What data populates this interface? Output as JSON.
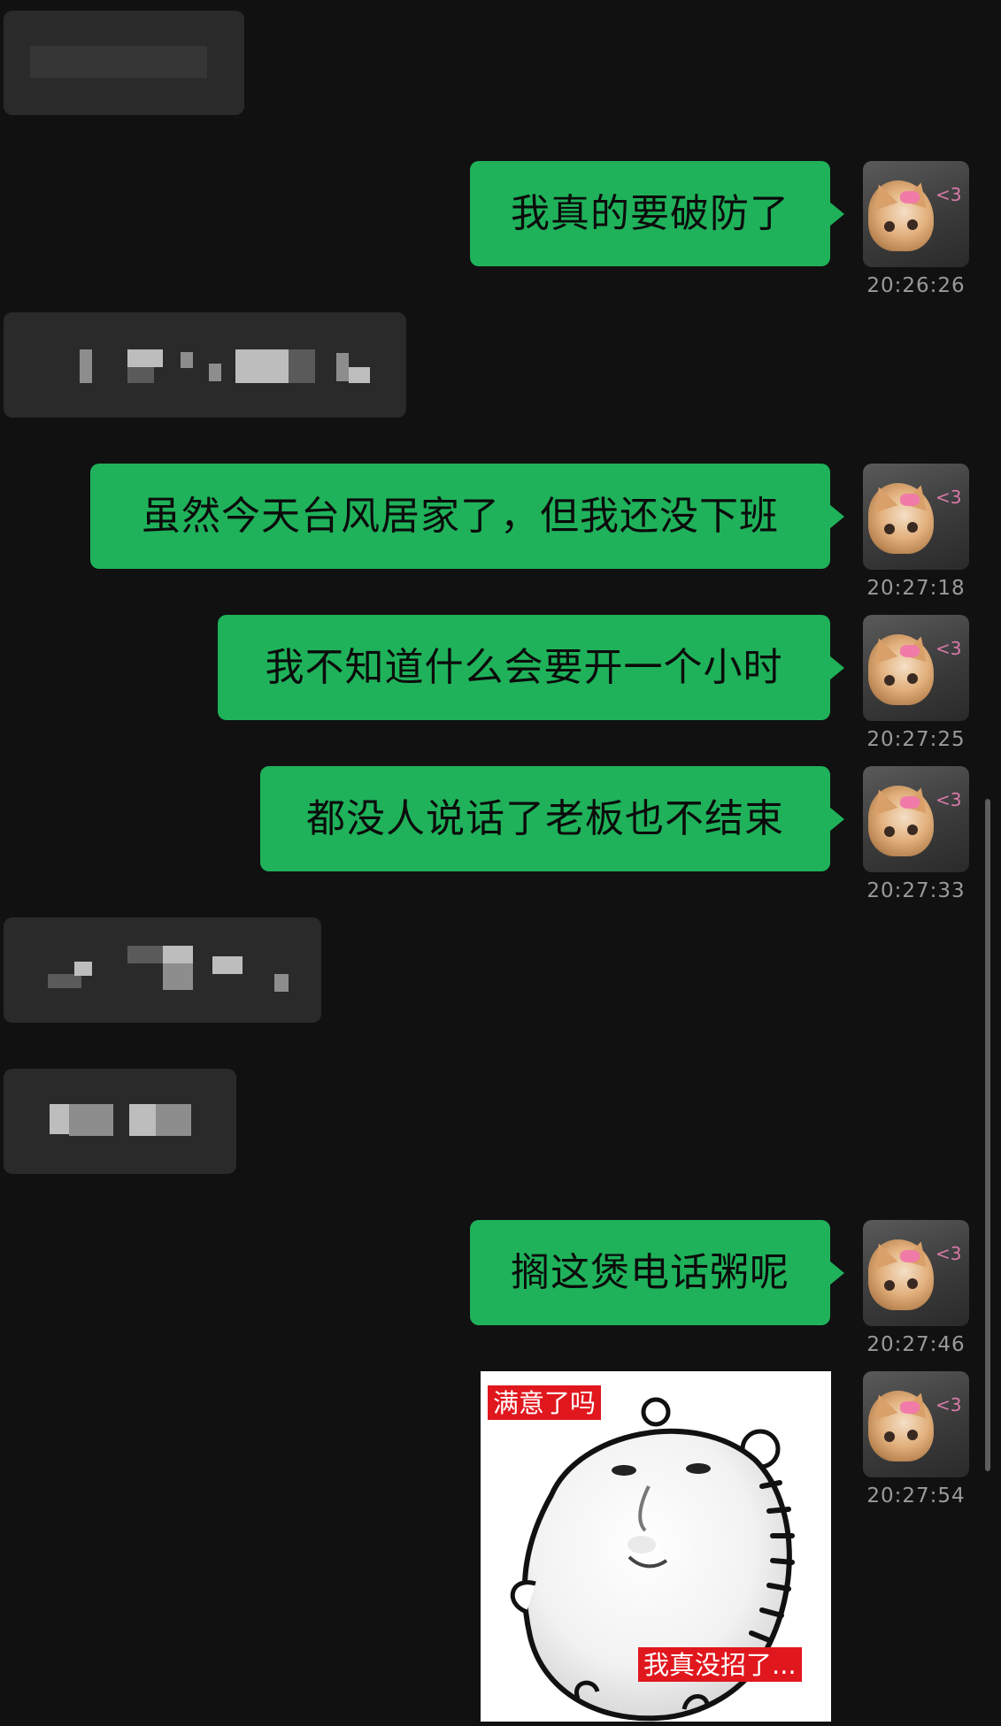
{
  "messages": [
    {
      "side": "in",
      "text": ""
    },
    {
      "side": "out",
      "text": "我真的要破防了",
      "time": "20:26:26"
    },
    {
      "side": "in",
      "text": ""
    },
    {
      "side": "out",
      "text": "虽然今天台风居家了，但我还没下班",
      "time": "20:27:18"
    },
    {
      "side": "out",
      "text": "我不知道什么会要开一个小时",
      "time": "20:27:25"
    },
    {
      "side": "out",
      "text": "都没人说话了老板也不结束",
      "time": "20:27:33"
    },
    {
      "side": "in",
      "text": ""
    },
    {
      "side": "in",
      "text": ""
    },
    {
      "side": "out",
      "text": "搁这煲电话粥呢",
      "time": "20:27:46"
    },
    {
      "side": "out",
      "type": "sticker",
      "time": "20:27:54"
    }
  ],
  "sticker": {
    "top_text": "满意了吗",
    "bottom_text": "我真没招了..."
  },
  "avatar_icon": "kitten-with-pink-bow-avatar",
  "colors": {
    "background": "#111111",
    "bubble_out": "#1fb25a",
    "bubble_in": "#2a2a2a",
    "timestamp": "#9a9a9a",
    "sticker_label": "#e1171e"
  }
}
